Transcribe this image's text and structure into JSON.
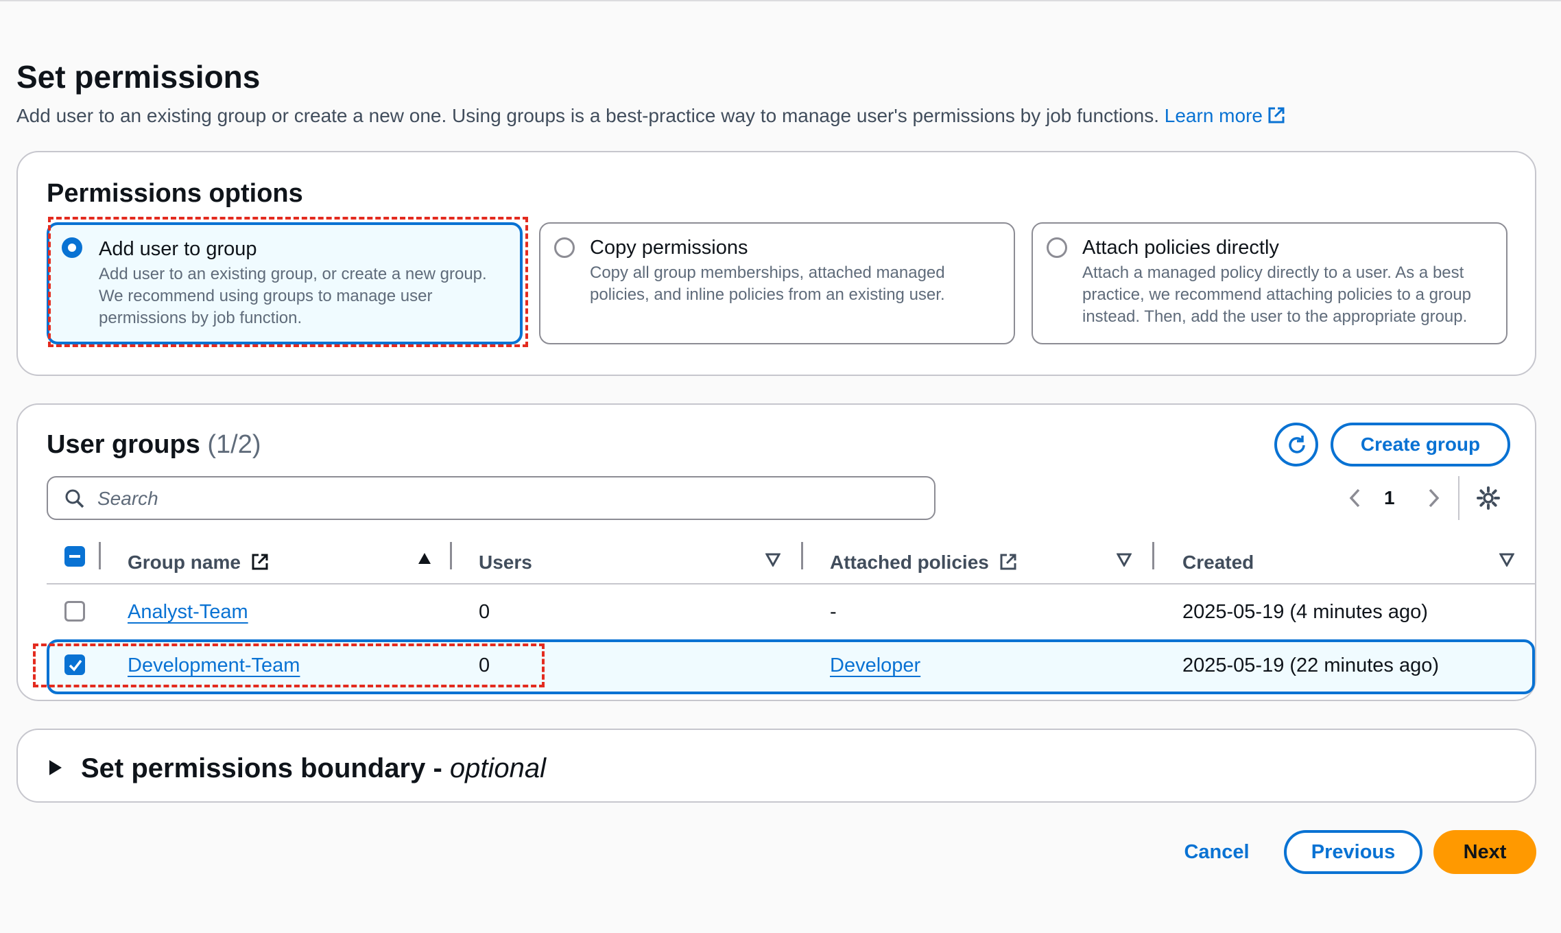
{
  "header": {
    "title": "Set permissions",
    "description": "Add user to an existing group or create a new one. Using groups is a best-practice way to manage user's permissions by job functions.",
    "learn_more": "Learn more"
  },
  "permissions_options": {
    "title": "Permissions options",
    "tiles": [
      {
        "title": "Add user to group",
        "description": "Add user to an existing group, or create a new group. We recommend using groups to manage user permissions by job function.",
        "selected": true
      },
      {
        "title": "Copy permissions",
        "description": "Copy all group memberships, attached managed policies, and inline policies from an existing user.",
        "selected": false
      },
      {
        "title": "Attach policies directly",
        "description": "Attach a managed policy directly to a user. As a best practice, we recommend attaching policies to a group instead. Then, add the user to the appropriate group.",
        "selected": false
      }
    ]
  },
  "user_groups": {
    "title": "User groups",
    "count": "(1/2)",
    "create_group": "Create group",
    "search_placeholder": "Search",
    "page": "1",
    "columns": [
      "Group name",
      "Users",
      "Attached policies",
      "Created"
    ],
    "rows": [
      {
        "name": "Analyst-Team",
        "users": "0",
        "policies": "-",
        "created": "2025-05-19 (4 minutes ago)",
        "checked": false
      },
      {
        "name": "Development-Team",
        "users": "0",
        "policies": "Developer",
        "created": "2025-05-19 (22 minutes ago)",
        "checked": true
      }
    ]
  },
  "boundary": {
    "title": "Set permissions boundary - ",
    "optional": "optional"
  },
  "footer": {
    "cancel": "Cancel",
    "previous": "Previous",
    "next": "Next"
  },
  "colors": {
    "accent": "#0972d3",
    "primary_button": "#ff9900",
    "annotation": "#e32b1f"
  }
}
